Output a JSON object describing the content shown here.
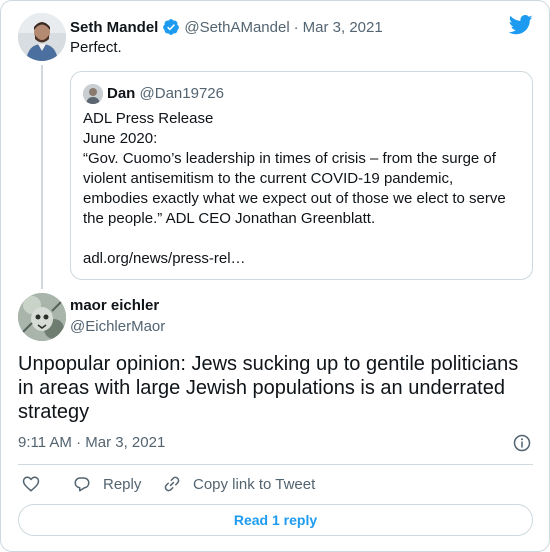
{
  "brand": {
    "icon": "twitter-bird-icon",
    "color": "#1d9bf0"
  },
  "parent_tweet": {
    "name": "Seth Mandel",
    "handle": "@SethAMandel",
    "separator": "·",
    "date": "Mar 3, 2021",
    "verified": true,
    "text": "Perfect.",
    "quote": {
      "name": "Dan",
      "handle": "@Dan19726",
      "lines": [
        "ADL Press Release",
        "June 2020:",
        "“Gov. Cuomo’s leadership in times of crisis – from the surge of",
        "violent antisemitism to the current COVID-19 pandemic,",
        "embodies exactly what we expect out of those we elect to serve",
        "the people.” ADL CEO Jonathan Greenblatt.",
        "",
        "adl.org/news/press-rel…"
      ]
    }
  },
  "main_tweet": {
    "name": "maor eichler",
    "handle": "@EichlerMaor",
    "text_lines": [
      "Unpopular opinion: Jews sucking up to gentile politicians",
      "in areas with large Jewish populations is an underrated",
      "strategy"
    ],
    "timestamp": "9:11 AM · Mar 3, 2021"
  },
  "actions": {
    "reply_label": "Reply",
    "copy_label": "Copy link to Tweet"
  },
  "read_replies_label": "Read 1 reply",
  "colors": {
    "text": "#0f1419",
    "secondary": "#536471",
    "border": "#cfd9de",
    "accent": "#1d9bf0"
  }
}
